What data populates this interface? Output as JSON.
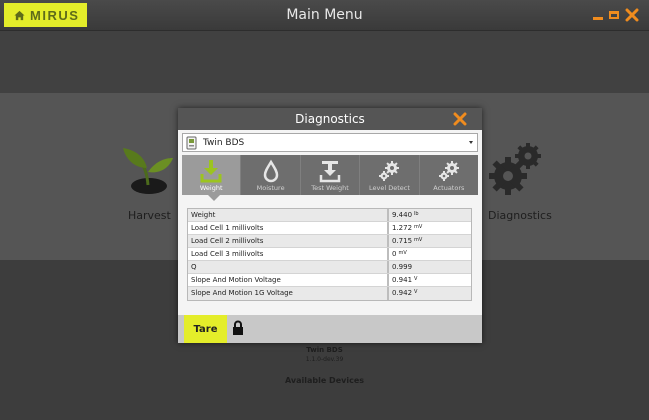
{
  "app": {
    "logo_text": "MIRUS",
    "window_title": "Main Menu",
    "accent_color": "#e4ed2a",
    "control_color": "#f08c1e"
  },
  "background": {
    "harvest_label": "Harvest",
    "diagnostics_label": "Diagnostics",
    "device_name": "Twin BDS",
    "device_version": "1.1.0-dev.39",
    "available_devices": "Available Devices"
  },
  "dialog": {
    "title": "Diagnostics",
    "device_select": {
      "value": "Twin BDS",
      "icon": "device-icon"
    },
    "tabs": [
      {
        "label": "Weight",
        "icon": "weight-download-icon",
        "active": true
      },
      {
        "label": "Moisture",
        "icon": "droplet-icon",
        "active": false
      },
      {
        "label": "Test Weight",
        "icon": "test-weight-icon",
        "active": false
      },
      {
        "label": "Level Detect",
        "icon": "gears-icon",
        "active": false
      },
      {
        "label": "Actuators",
        "icon": "gears-icon",
        "active": false
      }
    ],
    "rows": [
      {
        "name": "Weight",
        "value": "9.440",
        "unit": "lb"
      },
      {
        "name": "Load Cell 1 millivolts",
        "value": "1.272",
        "unit": "mV"
      },
      {
        "name": "Load Cell 2 millivolts",
        "value": "0.715",
        "unit": "mV"
      },
      {
        "name": "Load Cell 3 millivolts",
        "value": "0",
        "unit": "mV"
      },
      {
        "name": "Q",
        "value": "0.999",
        "unit": ""
      },
      {
        "name": "Slope And Motion Voltage",
        "value": "0.941",
        "unit": "V"
      },
      {
        "name": "Slope And Motion 1G Voltage",
        "value": "0.942",
        "unit": "V"
      }
    ],
    "tare_label": "Tare"
  }
}
